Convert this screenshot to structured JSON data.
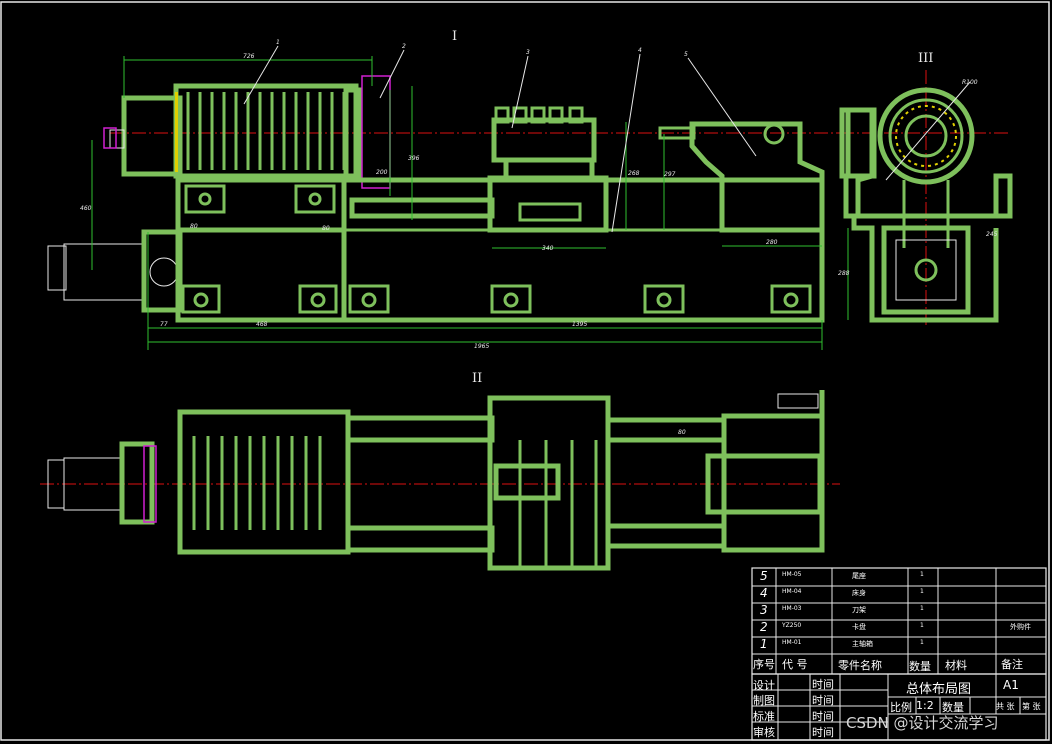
{
  "view_labels": {
    "top": "I",
    "right": "III",
    "bottom": "II"
  },
  "balloons": [
    "1",
    "2",
    "3",
    "4",
    "5"
  ],
  "dimensions": {
    "d726": "726",
    "d396": "396",
    "d200": "200",
    "d460": "460",
    "d80a": "80",
    "d80b": "80",
    "d340": "340",
    "d268": "268",
    "d297": "297",
    "d280": "280",
    "d77": "77",
    "d468": "468",
    "d1395": "1395",
    "d1965": "1965",
    "d288": "288",
    "d245": "245",
    "dR": "R100"
  },
  "parts_list": {
    "rows": [
      {
        "no": "5",
        "code": "HM-05",
        "name": "尾座",
        "qty": "1",
        "material": "",
        "note": ""
      },
      {
        "no": "4",
        "code": "HM-04",
        "name": "床身",
        "qty": "1",
        "material": "",
        "note": ""
      },
      {
        "no": "3",
        "code": "HM-03",
        "name": "刀架",
        "qty": "1",
        "material": "",
        "note": ""
      },
      {
        "no": "2",
        "code": "YZ250",
        "name": "卡盘",
        "qty": "1",
        "material": "",
        "note": "外购件"
      },
      {
        "no": "1",
        "code": "HM-01",
        "name": "主轴箱",
        "qty": "1",
        "material": "",
        "note": ""
      }
    ],
    "headers": {
      "no": "序号",
      "code": "代 号",
      "name": "零件名称",
      "qty": "数量",
      "material": "材料",
      "note": "备注"
    }
  },
  "title_block": {
    "design": "设计",
    "drawing": "制图",
    "standard": "标准",
    "review": "审核",
    "time": "时间",
    "title": "总体布局图",
    "sheet": "A1",
    "scale_label": "比例",
    "scale": "1:2",
    "qty_label": "数量",
    "sheet_cells": [
      "共 张",
      "第 张"
    ]
  },
  "watermark": "CSDN @设计交流学习"
}
